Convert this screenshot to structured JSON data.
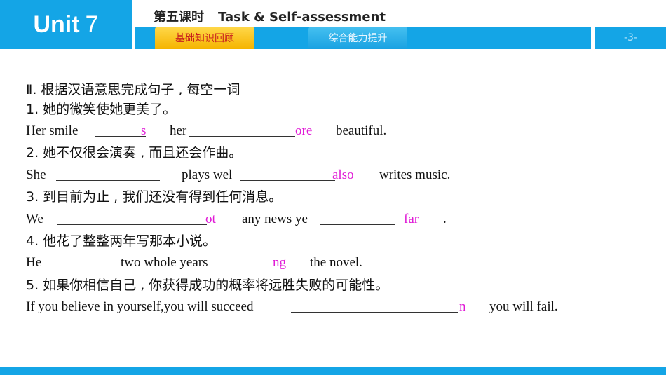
{
  "header": {
    "unit_label": "Unit",
    "unit_number": "7",
    "lesson": "第五课时",
    "lesson_title": "Task & Self-assessment",
    "tab_active": "基础知识回顾",
    "tab_other": "综合能力提升",
    "page": "-3-"
  },
  "section": {
    "title": "Ⅱ. 根据汉语意思完成句子 , 每空一词"
  },
  "items": [
    {
      "cn": "1. 她的微笑使她更美了。",
      "words": [
        "Her smile",
        "her",
        "beautiful."
      ],
      "answers": [
        "s",
        "ore"
      ]
    },
    {
      "cn": "2. 她不仅很会演奏 , 而且还会作曲。",
      "words": [
        "She",
        "plays wel",
        "writes music."
      ],
      "answers": [
        "",
        "also"
      ]
    },
    {
      "cn": "3. 到目前为止 , 我们还没有得到任何消息。",
      "words": [
        "We",
        "any news ye",
        "."
      ],
      "answers": [
        "ot",
        "far"
      ]
    },
    {
      "cn": "4. 他花了整整两年写那本小说。",
      "words": [
        "He",
        "two whole years",
        "the novel."
      ],
      "answers": [
        "",
        "ng"
      ]
    },
    {
      "cn": "5. 如果你相信自己 , 你获得成功的概率将远胜失败的可能性。",
      "words": [
        "If you believe in yourself,you will succeed",
        "you will fail."
      ],
      "answers": [
        "n"
      ]
    }
  ]
}
